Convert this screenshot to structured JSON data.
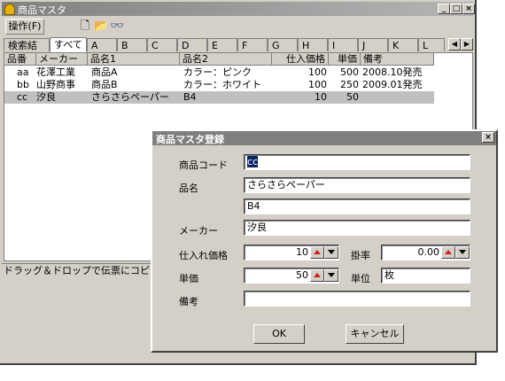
{
  "window": {
    "title": "商品マスタ"
  },
  "toolbar": {
    "menu_label": "操作(F)",
    "icons": [
      "new-file-icon",
      "open-folder-icon",
      "binoculars-icon"
    ]
  },
  "tabs": [
    "検索結果",
    "すべて",
    "A",
    "B",
    "C",
    "D",
    "E",
    "F",
    "G",
    "H",
    "I",
    "J",
    "K",
    "L"
  ],
  "table": {
    "headers": [
      "品番",
      "メーカー",
      "品名1",
      "品名2",
      "仕入価格",
      "単価",
      "備考"
    ],
    "rows": [
      {
        "code": "aa",
        "maker": "花澤工業",
        "name1": "商品A",
        "name2": "カラー：ピンク",
        "cost": "100",
        "price": "500",
        "note": "2008.10発売"
      },
      {
        "code": "bb",
        "maker": "山野商事",
        "name1": "商品B",
        "name2": "カラー：ホワイト",
        "cost": "100",
        "price": "250",
        "note": "2009.01発売"
      },
      {
        "code": "cc",
        "maker": "汐良",
        "name1": "さらさらペーパー",
        "name2": "B4",
        "cost": "10",
        "price": "50",
        "note": ""
      }
    ]
  },
  "status": "ドラッグ＆ドロップで伝票にコピーできます",
  "dialog": {
    "title": "商品マスタ登録",
    "labels": {
      "code": "商品コード",
      "name": "品名",
      "maker": "メーカー",
      "cost": "仕入れ価格",
      "rate": "掛率",
      "price": "単価",
      "unit": "単位",
      "note": "備考"
    },
    "values": {
      "code": "cc",
      "name1": "さらさらペーパー",
      "name2": "B4",
      "maker": "汐良",
      "cost": "10",
      "rate": "0.00",
      "price": "50",
      "unit": "枚",
      "note": ""
    },
    "ok": "OK",
    "cancel": "キャンセル"
  }
}
